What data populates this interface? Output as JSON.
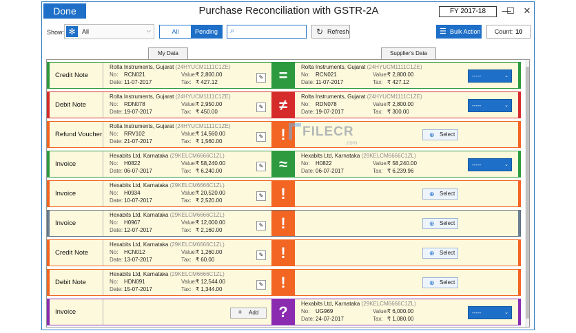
{
  "window": {
    "done_label": "Done",
    "title": "Purchase Reconciliation with GSTR-2A",
    "fy_label": "FY 2017-18",
    "minimize_glyph": "—",
    "maximize_glyph": "☐",
    "close_glyph": "✕"
  },
  "toolbar": {
    "show_label": "Show:",
    "show_value": "All",
    "show_icon": "asterisk-icon",
    "tabs": [
      "All",
      "Pending"
    ],
    "active_tab": "Pending",
    "search_placeholder": "",
    "refresh_label": "Refresh",
    "bulk_action_label": "Bulk Action",
    "count_label": "Count:",
    "count_value": "10"
  },
  "column_tabs": {
    "my_data": "My Data",
    "supplier_data": "Supplier's Data"
  },
  "labels": {
    "no": "No:",
    "date": "Date:",
    "value": "Value:",
    "tax": "Tax:",
    "select": "Select",
    "add": "Add",
    "dropdown": "-----"
  },
  "colors": {
    "green": "#2e9a40",
    "red": "#d62b2b",
    "orange": "#f26522",
    "purple": "#8a2bb0",
    "grey": "#6b7f95",
    "accent": "#1e6fc8",
    "row_bg": "#fdf9dc"
  },
  "watermark": {
    "text": "FILECR",
    "sub": ".com"
  },
  "rows": [
    {
      "type": "Credit Note",
      "bar": "green",
      "status": "=",
      "status_color": "green",
      "mine": {
        "party": "Rolta Instruments, Gujarat",
        "gstin": "(24HYUCM1111C1ZE)",
        "no": "RCN021",
        "date": "11-07-2017",
        "value": "₹ 2,800.00",
        "tax": "₹ 427.12"
      },
      "supplier": {
        "party": "Rolta Instruments, Gujarat",
        "gstin": "(24HYUCM1111C1ZE)",
        "no": "RCN021",
        "date": "11-07-2017",
        "value": "₹ 2,800.00",
        "tax": "₹ 427.12"
      },
      "action": "dropdown"
    },
    {
      "type": "Debit Note",
      "bar": "red",
      "status": "≠",
      "status_color": "red",
      "mine": {
        "party": "Rolta Instruments, Gujarat",
        "gstin": "(24HYUCM1111C1ZE)",
        "no": "RDN078",
        "date": "19-07-2017",
        "value": "₹ 2,950.00",
        "tax": "₹ 450.00"
      },
      "supplier": {
        "party": "Rolta Instruments, Gujarat",
        "gstin": "(24HYUCM1111C1ZE)",
        "no": "RDN078",
        "date": "19-07-2017",
        "value": "₹ 2,800.00",
        "tax": "₹ 300.00"
      },
      "action": "dropdown"
    },
    {
      "type": "Refund Voucher",
      "bar": "orange",
      "status": "!",
      "status_color": "orange",
      "mine": {
        "party": "Rolta Instruments, Gujarat",
        "gstin": "(24HYUCM1111C1ZE)",
        "no": "RRV102",
        "date": "21-07-2017",
        "value": "₹ 14,560.00",
        "tax": "₹ 1,560.00"
      },
      "supplier": null,
      "action": "select"
    },
    {
      "type": "Invoice",
      "bar": "green",
      "status": "≈",
      "status_color": "green",
      "mine": {
        "party": "Hexabits Ltd, Karnataka",
        "gstin": "(29KELCM6666C1ZL)",
        "no": "H0822",
        "date": "06-07-2017",
        "value": "₹ 58,240.00",
        "tax": "₹ 6,240.00"
      },
      "supplier": {
        "party": "Hexabits Ltd, Karnataka",
        "gstin": "(29KELCM6666C1ZL)",
        "no": "H0822",
        "date": "06-07-2017",
        "value": "₹ 58,240.00",
        "tax": "₹ 6,239.96"
      },
      "action": "dropdown"
    },
    {
      "type": "Invoice",
      "bar": "orange",
      "status": "!",
      "status_color": "orange",
      "mine": {
        "party": "Hexabits Ltd, Karnataka",
        "gstin": "(29KELCM6666C1ZL)",
        "no": "H0934",
        "date": "10-07-2017",
        "value": "₹ 20,520.00",
        "tax": "₹ 2,520.00"
      },
      "supplier": null,
      "action": "select"
    },
    {
      "type": "Invoice",
      "bar": "grey",
      "status": "!",
      "status_color": "orange",
      "selected": true,
      "mine": {
        "party": "Hexabits Ltd, Karnataka",
        "gstin": "(29KELCM6666C1ZL)",
        "no": "H0967",
        "date": "12-07-2017",
        "value": "₹ 12,000.00",
        "tax": "₹ 2,160.00"
      },
      "supplier": null,
      "action": "select"
    },
    {
      "type": "Credit Note",
      "bar": "orange",
      "status": "!",
      "status_color": "orange",
      "mine": {
        "party": "Hexabits Ltd, Karnataka",
        "gstin": "(29KELCM6666C1ZL)",
        "no": "HCN012",
        "date": "13-07-2017",
        "value": "₹ 1,260.00",
        "tax": "₹ 60.00"
      },
      "supplier": null,
      "action": "select"
    },
    {
      "type": "Debit Note",
      "bar": "orange",
      "status": "!",
      "status_color": "orange",
      "mine": {
        "party": "Hexabits Ltd, Karnataka",
        "gstin": "(29KELCM6666C1ZL)",
        "no": "HDN091",
        "date": "15-07-2017",
        "value": "₹ 12,544.00",
        "tax": "₹ 1,344.00"
      },
      "supplier": null,
      "action": "select"
    },
    {
      "type": "Invoice",
      "bar": "purple",
      "status": "?",
      "status_color": "purple",
      "mine": null,
      "supplier": {
        "party": "Hexabits Ltd, Karnataka",
        "gstin": "(29KELCM6666C1ZL)",
        "no": "UG969",
        "date": "24-07-2017",
        "value": "₹ 6,000.00",
        "tax": "₹ 1,080.00"
      },
      "action": "dropdown"
    }
  ]
}
